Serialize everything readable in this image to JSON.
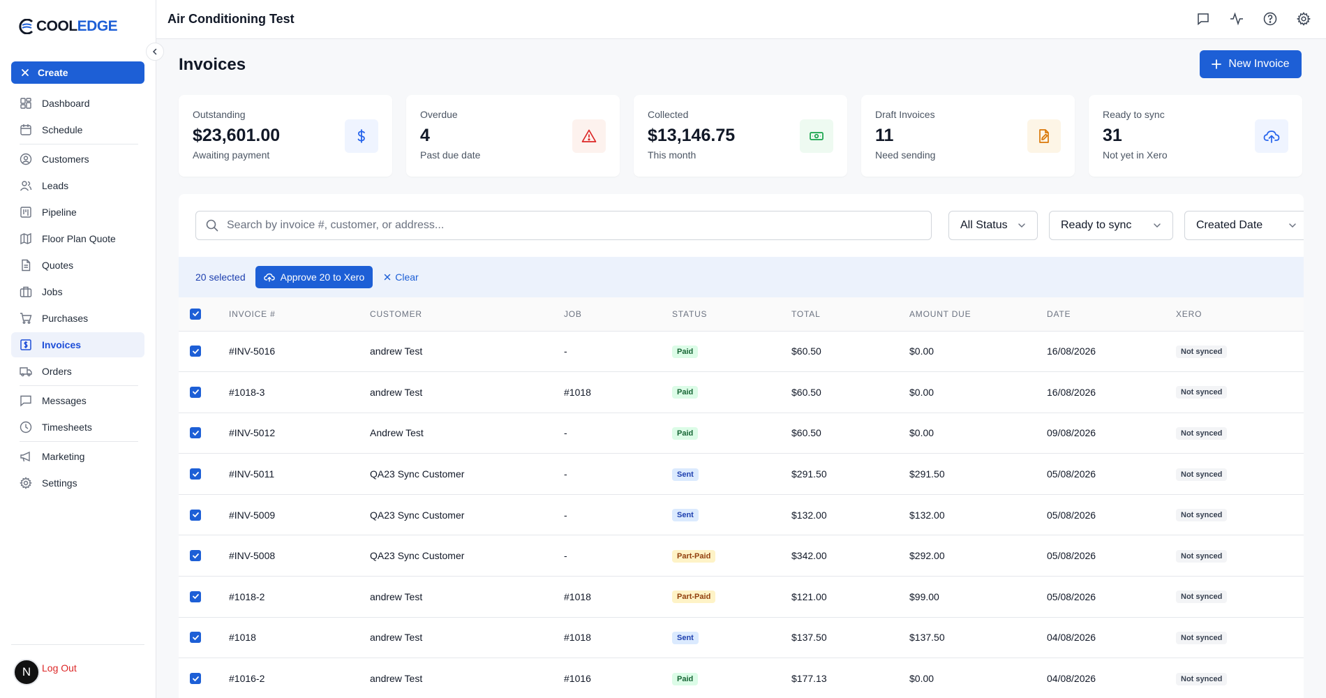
{
  "app": {
    "logo_part1": "COOL",
    "logo_part2": "EDGE",
    "workspace_title": "Air Conditioning Test"
  },
  "sidebar": {
    "create_label": "Create",
    "items": [
      {
        "label": "Dashboard",
        "icon": "dashboard-icon"
      },
      {
        "label": "Schedule",
        "icon": "calendar-icon"
      },
      {
        "label": "Customers",
        "icon": "user-circle-icon"
      },
      {
        "label": "Leads",
        "icon": "users-icon"
      },
      {
        "label": "Pipeline",
        "icon": "kanban-icon"
      },
      {
        "label": "Floor Plan Quote",
        "icon": "map-icon"
      },
      {
        "label": "Quotes",
        "icon": "document-icon"
      },
      {
        "label": "Jobs",
        "icon": "briefcase-icon"
      },
      {
        "label": "Purchases",
        "icon": "cart-icon"
      },
      {
        "label": "Invoices",
        "icon": "invoice-dollar-icon",
        "active": true
      },
      {
        "label": "Orders",
        "icon": "truck-icon"
      },
      {
        "label": "Messages",
        "icon": "message-icon"
      },
      {
        "label": "Timesheets",
        "icon": "clock-icon"
      },
      {
        "label": "Marketing",
        "icon": "megaphone-icon"
      },
      {
        "label": "Settings",
        "icon": "gear-icon"
      }
    ],
    "avatar_initial": "N",
    "logout_label": "Log Out"
  },
  "page": {
    "title": "Invoices",
    "new_button_label": "New Invoice"
  },
  "stats": [
    {
      "label": "Outstanding",
      "value": "$23,601.00",
      "sub": "Awaiting payment",
      "icon": "dollar-icon",
      "color": "#2563eb",
      "bg": "#eff4ff"
    },
    {
      "label": "Overdue",
      "value": "4",
      "sub": "Past due date",
      "icon": "warning-icon",
      "color": "#dc2626",
      "bg": "#fdf2ee"
    },
    {
      "label": "Collected",
      "value": "$13,146.75",
      "sub": "This month",
      "icon": "cash-icon",
      "color": "#16a34a",
      "bg": "#eefaf1"
    },
    {
      "label": "Draft Invoices",
      "value": "11",
      "sub": "Need sending",
      "icon": "file-edit-icon",
      "color": "#d97706",
      "bg": "#fdf5e6"
    },
    {
      "label": "Ready to sync",
      "value": "31",
      "sub": "Not yet in Xero",
      "icon": "cloud-upload-icon",
      "color": "#2563eb",
      "bg": "#eff4ff"
    }
  ],
  "filters": {
    "search_placeholder": "Search by invoice #, customer, or address...",
    "status_value": "All Status",
    "sync_value": "Ready to sync",
    "sort_value": "Created Date"
  },
  "selection": {
    "count_label": "20 selected",
    "approve_label": "Approve 20 to Xero",
    "clear_label": "Clear"
  },
  "table": {
    "columns": [
      "INVOICE #",
      "CUSTOMER",
      "JOB",
      "STATUS",
      "TOTAL",
      "AMOUNT DUE",
      "DATE",
      "XERO"
    ],
    "rows": [
      {
        "invoice": "#INV-5016",
        "customer": "andrew Test",
        "job": "-",
        "status": "Paid",
        "total": "$60.50",
        "due": "$0.00",
        "date": "16/08/2026",
        "xero": "Not synced"
      },
      {
        "invoice": "#1018-3",
        "customer": "andrew Test",
        "job": "#1018",
        "status": "Paid",
        "total": "$60.50",
        "due": "$0.00",
        "date": "16/08/2026",
        "xero": "Not synced"
      },
      {
        "invoice": "#INV-5012",
        "customer": "Andrew Test",
        "job": "-",
        "status": "Paid",
        "total": "$60.50",
        "due": "$0.00",
        "date": "09/08/2026",
        "xero": "Not synced"
      },
      {
        "invoice": "#INV-5011",
        "customer": "QA23 Sync Customer",
        "job": "-",
        "status": "Sent",
        "total": "$291.50",
        "due": "$291.50",
        "date": "05/08/2026",
        "xero": "Not synced"
      },
      {
        "invoice": "#INV-5009",
        "customer": "QA23 Sync Customer",
        "job": "-",
        "status": "Sent",
        "total": "$132.00",
        "due": "$132.00",
        "date": "05/08/2026",
        "xero": "Not synced"
      },
      {
        "invoice": "#INV-5008",
        "customer": "QA23 Sync Customer",
        "job": "-",
        "status": "Part-Paid",
        "total": "$342.00",
        "due": "$292.00",
        "date": "05/08/2026",
        "xero": "Not synced"
      },
      {
        "invoice": "#1018-2",
        "customer": "andrew Test",
        "job": "#1018",
        "status": "Part-Paid",
        "total": "$121.00",
        "due": "$99.00",
        "date": "05/08/2026",
        "xero": "Not synced"
      },
      {
        "invoice": "#1018",
        "customer": "andrew Test",
        "job": "#1018",
        "status": "Sent",
        "total": "$137.50",
        "due": "$137.50",
        "date": "04/08/2026",
        "xero": "Not synced"
      },
      {
        "invoice": "#1016-2",
        "customer": "andrew Test",
        "job": "#1016",
        "status": "Paid",
        "total": "$177.13",
        "due": "$0.00",
        "date": "04/08/2026",
        "xero": "Not synced"
      }
    ]
  },
  "colors": {
    "accent": "#1d5fd6",
    "paid": "#dcfce7",
    "sent": "#dbeafe",
    "part_paid": "#fef3c7"
  }
}
